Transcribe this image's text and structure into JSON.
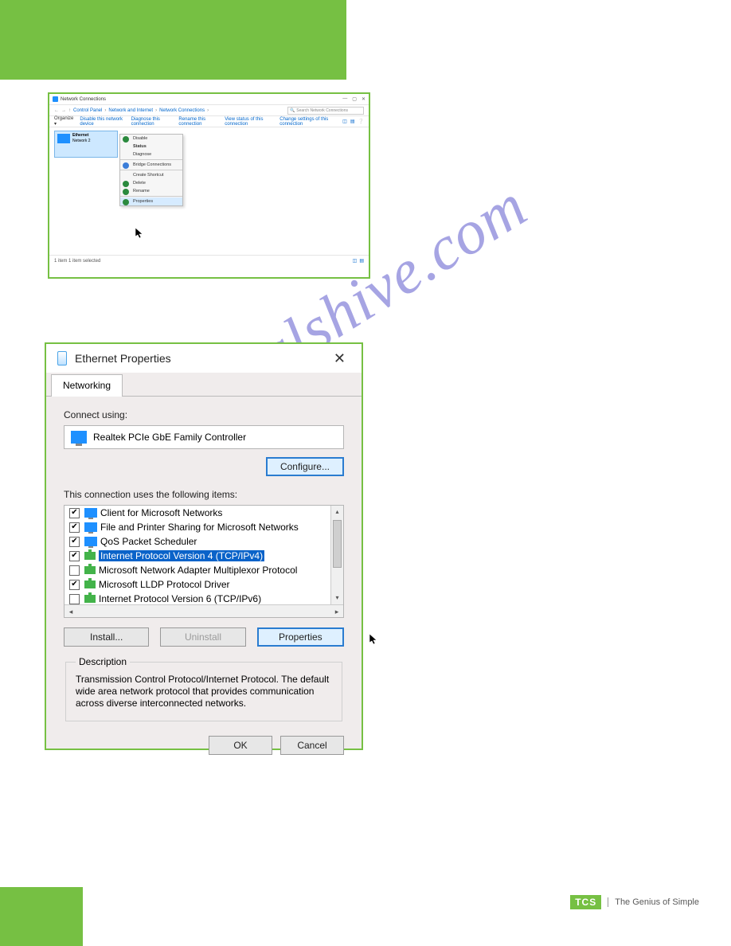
{
  "watermark": "manualshive.com",
  "win1": {
    "title": "Network Connections",
    "breadcrumbs": [
      "Control Panel",
      "Network and Internet",
      "Network Connections"
    ],
    "search_placeholder": "Search Network Connections",
    "toolbar": {
      "organize": "Organize ▾",
      "items": [
        "Disable this network device",
        "Diagnose this connection",
        "Rename this connection",
        "View status of this connection",
        "Change settings of this connection"
      ]
    },
    "adapter": {
      "name": "Ethernet",
      "line2": "Network 2"
    },
    "context_menu": [
      {
        "label": "Disable",
        "icon": "#2b8a3e"
      },
      {
        "label": "Status",
        "bold": true
      },
      {
        "label": "Diagnose"
      },
      {
        "sep": true
      },
      {
        "label": "Bridge Connections",
        "icon": "#3b7dd8"
      },
      {
        "sep": true
      },
      {
        "label": "Create Shortcut"
      },
      {
        "label": "Delete",
        "icon": "#2b8a3e"
      },
      {
        "label": "Rename",
        "icon": "#2b8a3e"
      },
      {
        "sep": true
      },
      {
        "label": "Properties",
        "icon": "#2b8a3e",
        "hover": true
      }
    ],
    "status_left": "1 item     1 item selected"
  },
  "dlg": {
    "title": "Ethernet Properties",
    "close": "✕",
    "tab": "Networking",
    "connect_using_label": "Connect using:",
    "adapter": "Realtek PCIe GbE Family Controller",
    "configure": "Configure...",
    "list_label": "This connection uses the following items:",
    "items": [
      {
        "checked": true,
        "icon": "mon",
        "label": "Client for Microsoft Networks"
      },
      {
        "checked": true,
        "icon": "mon",
        "label": "File and Printer Sharing for Microsoft Networks"
      },
      {
        "checked": true,
        "icon": "mon",
        "label": "QoS Packet Scheduler"
      },
      {
        "checked": true,
        "icon": "net",
        "label": "Internet Protocol Version 4 (TCP/IPv4)",
        "selected": true
      },
      {
        "checked": false,
        "icon": "net",
        "label": "Microsoft Network Adapter Multiplexor Protocol"
      },
      {
        "checked": true,
        "icon": "net",
        "label": "Microsoft LLDP Protocol Driver"
      },
      {
        "checked": false,
        "icon": "net",
        "label": "Internet Protocol Version 6 (TCP/IPv6)"
      }
    ],
    "install": "Install...",
    "uninstall": "Uninstall",
    "properties": "Properties",
    "desc_legend": "Description",
    "desc_text": "Transmission Control Protocol/Internet Protocol. The default wide area network protocol that provides communication across diverse interconnected networks.",
    "ok": "OK",
    "cancel": "Cancel"
  },
  "footer": {
    "logo": "TCS",
    "tagline": "The Genius of Simple"
  }
}
